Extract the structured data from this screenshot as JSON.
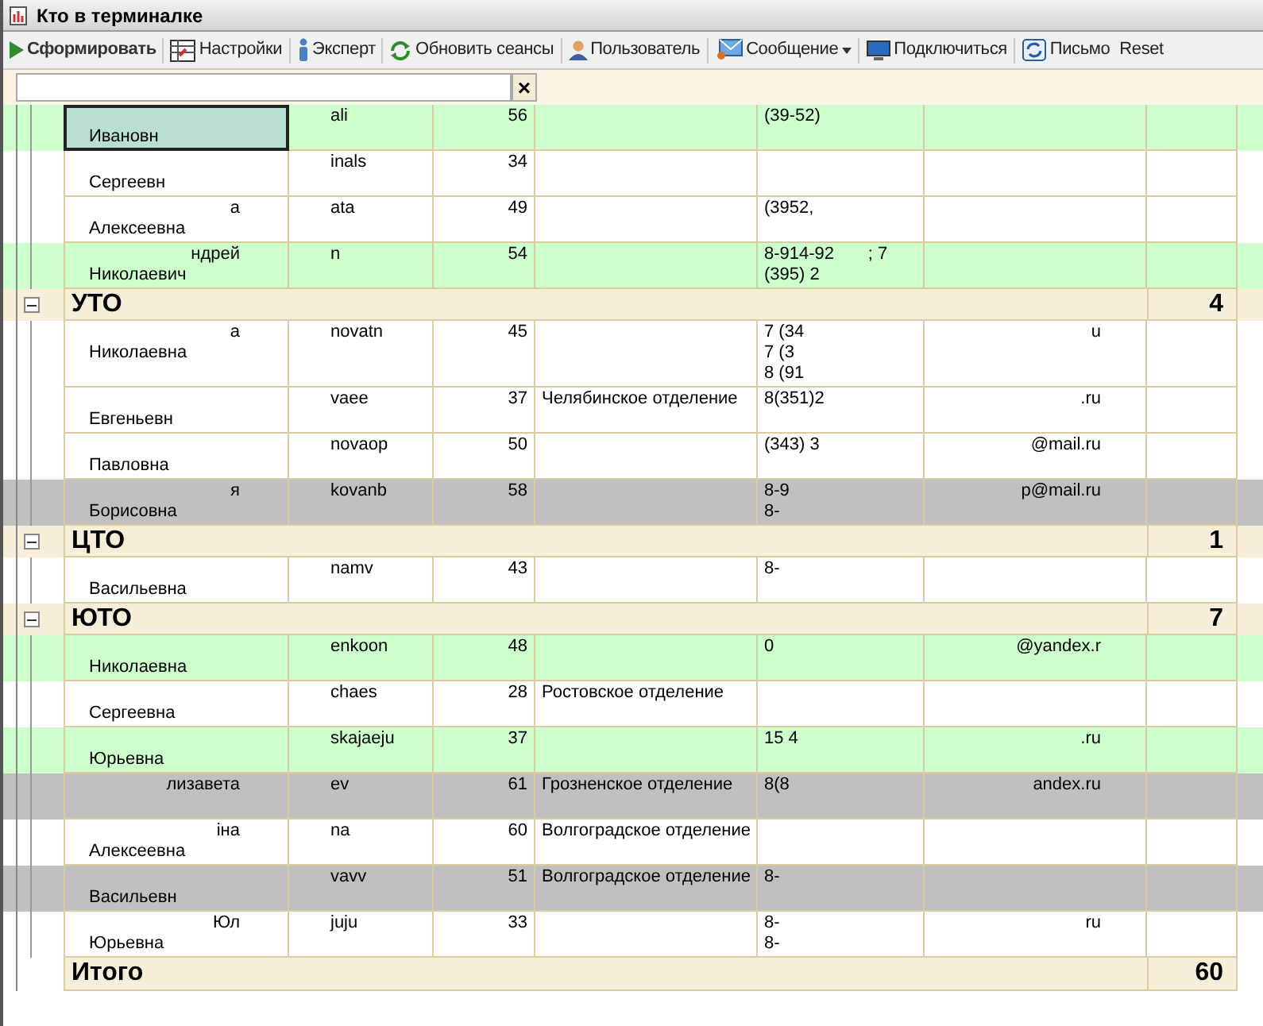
{
  "window": {
    "title": "Кто в терминалке"
  },
  "toolbar": [
    {
      "label": "Сформировать",
      "bold": true
    },
    {
      "label": "Настройки",
      "bold": false
    },
    {
      "label": "Эксперт",
      "bold": false
    },
    {
      "label": "Обновить сеансы",
      "bold": false
    },
    {
      "label": "Пользователь",
      "bold": false
    },
    {
      "label": "Сообщение",
      "bold": false,
      "dropdown": true
    },
    {
      "label": "Подключиться",
      "bold": false
    },
    {
      "label": "Письмо",
      "bold": false
    },
    {
      "label": "Reset",
      "bold": false
    }
  ],
  "filter": {
    "clear_button": "×"
  },
  "table": {
    "groups": [
      {
        "rows": [
          {
            "color": "#ccffcc",
            "selected": true,
            "name_2": "Ивановн",
            "login": "ali",
            "age": "56",
            "phone": [
              "(39-52)"
            ]
          },
          {
            "color": "#ffffff",
            "selected": false,
            "name_2": "Сергеевн",
            "login": "inals",
            "age": "34"
          },
          {
            "color": "#ffffff",
            "selected": false,
            "name_1": "а",
            "name_2": "Алексеевна",
            "login": "ata",
            "age": "49",
            "phone": [
              "(3952,"
            ]
          },
          {
            "color": "#ccffcc",
            "selected": false,
            "name_1": "ндрей",
            "name_2": "Николаевич",
            "login": "n",
            "age": "54",
            "phone": [
              "8-914-92       ; 7",
              "(395) 2"
            ]
          }
        ]
      },
      {
        "title": "УТО",
        "count": "4",
        "expanded": true,
        "rows": [
          {
            "color": "#ffffff",
            "selected": false,
            "name_1": "а",
            "name_2": "Николаевна",
            "login": "novatn",
            "age": "45",
            "phone": [
              "7 (34",
              "7 (3",
              "8 (91"
            ],
            "email": "u"
          },
          {
            "color": "#ffffff",
            "selected": false,
            "name_2": "Евгеньевн",
            "login": "vaee",
            "age": "37",
            "department": "Челябинское отделение",
            "phone": [
              "8(351)2"
            ],
            "email": ".ru"
          },
          {
            "color": "#ffffff",
            "selected": false,
            "name_2": "Павловна",
            "login": "novaop",
            "age": "50",
            "phone": [
              "(343) 3"
            ],
            "email": "@mail.ru"
          },
          {
            "color": "#c0c0c0",
            "selected": false,
            "name_1": "я",
            "name_2": "Борисовна",
            "login": "kovanb",
            "age": "58",
            "phone": [
              "8-9",
              "8-"
            ],
            "email": "p@mail.ru"
          }
        ]
      },
      {
        "title": "ЦТО",
        "count": "1",
        "expanded": true,
        "rows": [
          {
            "color": "#ffffff",
            "selected": false,
            "name_2": "Васильевна",
            "login": "namv",
            "age": "43",
            "phone": [
              "8-"
            ]
          }
        ]
      },
      {
        "title": "ЮТО",
        "count": "7",
        "expanded": true,
        "rows": [
          {
            "color": "#ccffcc",
            "selected": false,
            "name_2": "Николаевна",
            "login": "enkoon",
            "age": "48",
            "phone": [
              "0"
            ],
            "email": "@yandex.r"
          },
          {
            "color": "#ffffff",
            "selected": false,
            "name_2": "Сергеевна",
            "login": "chaes",
            "age": "28",
            "department": "Ростовское отделение"
          },
          {
            "color": "#ccffcc",
            "selected": false,
            "name_2": "Юрьевна",
            "login": "skajaeju",
            "age": "37",
            "phone": [
              "15 4"
            ],
            "email": ".ru"
          },
          {
            "color": "#c0c0c0",
            "selected": false,
            "name_1": "лизавета",
            "login": "ev",
            "age": "61",
            "department": "Грозненское отделение",
            "phone": [
              "8(8"
            ],
            "email": "andex.ru"
          },
          {
            "color": "#ffffff",
            "selected": false,
            "name_1": "іна",
            "name_2": "Алексеевна",
            "login": "na",
            "age": "60",
            "department": "Волгоградское отделение"
          },
          {
            "color": "#c0c0c0",
            "selected": false,
            "name_2": "Васильевн",
            "login": "vavv",
            "age": "51",
            "department": "Волгоградское отделение",
            "phone": [
              "8-"
            ]
          },
          {
            "color": "#ffffff",
            "selected": false,
            "name_1": "Юл",
            "name_2": "Юрьевна",
            "login": "juju",
            "age": "33",
            "phone": [
              "8-",
              "8-"
            ],
            "email": "ru"
          }
        ]
      }
    ],
    "total": {
      "label": "Итого",
      "count": "60"
    }
  }
}
